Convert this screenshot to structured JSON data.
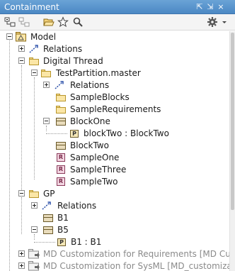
{
  "panel": {
    "title": "Containment",
    "title_buttons": [
      "⇱",
      "⇲",
      "×"
    ]
  },
  "toolbar": {
    "icons": [
      "collapse-all-icon",
      "expand-all-icon",
      "open-folder-icon",
      "star-icon",
      "search-icon",
      "gear-icon",
      "dropdown-arrow-icon"
    ]
  },
  "tree": {
    "model": "Model",
    "relations_1": "Relations",
    "digital_thread": "Digital Thread",
    "test_partition": "TestPartition.master",
    "relations_2": "Relations",
    "sample_blocks": "SampleBlocks",
    "sample_requirements": "SampleRequirements",
    "block_one": "BlockOne",
    "block_two_part": "blockTwo : BlockTwo",
    "block_two": "BlockTwo",
    "sample_one": "SampleOne",
    "sample_three": "SampleThree",
    "sample_two": "SampleTwo",
    "gp": "GP",
    "relations_3": "Relations",
    "b1": "B1",
    "b5": "B5",
    "b1_part": "B1 : B1",
    "md_req": "MD Customization for Requirements [MD Cust",
    "md_sysml": "MD Customization for SysML [MD_customizatio"
  },
  "icon_letters": {
    "requirement": "R",
    "part": "P"
  }
}
